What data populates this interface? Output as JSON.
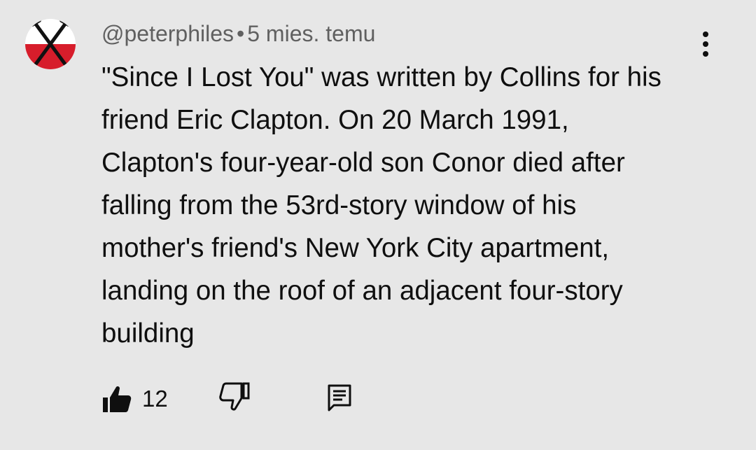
{
  "comment": {
    "author": "@peterphiles",
    "separator": "•",
    "timestamp": "5 mies. temu",
    "text": "\"Since I Lost You\" was written by Collins for his friend Eric Clapton. On 20 March 1991, Clapton's four-year-old son Conor died after falling from the 53rd-story window of his mother's friend's New York City apartment, landing on the roof of an adjacent four-story building",
    "like_count": "12"
  },
  "icons": {
    "avatar": "avatar-crossed-hammers",
    "menu": "more-vert-icon",
    "like": "thumb-up-icon",
    "dislike": "thumb-down-icon",
    "reply": "comment-reply-icon"
  },
  "colors": {
    "background": "#e7e7e7",
    "text": "#0f0f0f",
    "meta_text": "#606060",
    "avatar_red": "#d71d2b",
    "avatar_white": "#ffffff"
  }
}
